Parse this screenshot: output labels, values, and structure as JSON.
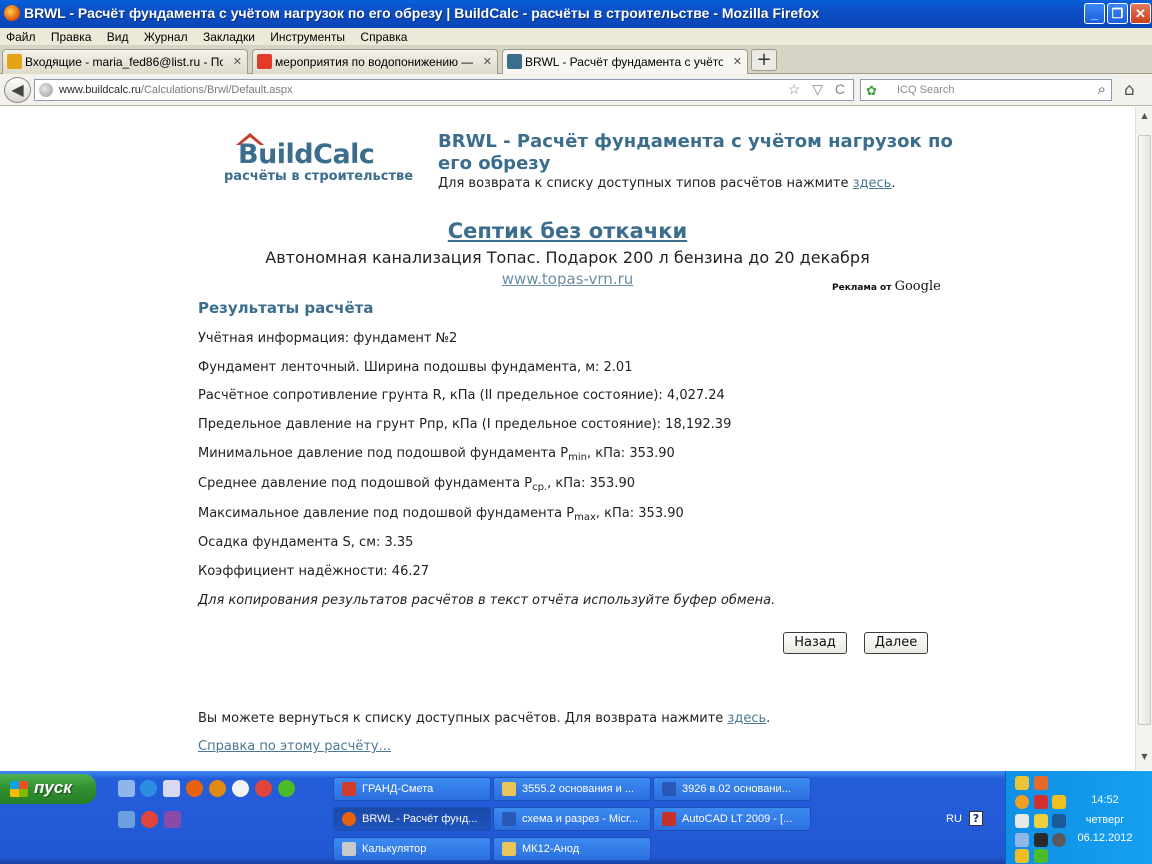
{
  "window": {
    "title": "BRWL - Расчёт фундамента с учётом нагрузок по его обрезу | BuildCalc - расчёты в строительстве - Mozilla Firefox",
    "minimize": "_",
    "maximize": "❐",
    "close": "✕"
  },
  "menu": [
    "Файл",
    "Правка",
    "Вид",
    "Журнал",
    "Закладки",
    "Инструменты",
    "Справка"
  ],
  "tabs": [
    {
      "label": "Входящие - maria_fed86@list.ru - Почт...",
      "icon_color": "#e5a415"
    },
    {
      "label": "мероприятия по водопонижению — Ян...",
      "icon_color": "#e23b2a"
    },
    {
      "label": "BRWL - Расчёт фундамента с учётом н...",
      "icon_color": "#3b6d8d"
    }
  ],
  "new_tab_label": "+",
  "nav": {
    "back": "◀",
    "url_host": "www.buildcalc.ru",
    "url_path": "/Calculations/Brwl/Default.aspx",
    "url_tools": "☆ ▽ C",
    "search_engine_icon": "✿",
    "search_placeholder": "ICQ Search",
    "search_icon": "⌕",
    "home_icon": "⌂"
  },
  "page": {
    "logo_name": "BuildCalc",
    "logo_tagline": "расчёты в строительстве",
    "title": "BRWL - Расчёт фундамента с учётом нагрузок по его обрезу",
    "return_text": "Для возврата к списку доступных типов расчётов нажмите ",
    "return_link": "здесь",
    "return_tail": ".",
    "ad": {
      "title": "Септик без откачки",
      "text": "Автономная канализация Топас. Подарок 200 л бензина до 20 декабря",
      "url": "www.topas-vrn.ru",
      "google_prefix": "Реклама от ",
      "google_brand": "Google"
    },
    "results_heading": "Результаты расчёта",
    "rows": [
      "Учётная информация: фундамент №2",
      "Фундамент ленточный. Ширина подошвы фундамента, м: 2.01",
      "Расчётное сопротивление грунта R, кПа (II предельное состояние): 4,027.24",
      "Предельное давление на грунт Pпр, кПа (I предельное состояние): 18,192.39"
    ],
    "pmin": {
      "pre": "Минимальное давление под подошвой фундамента P",
      "sub": "min",
      "post": ", кПа: 353.90"
    },
    "pcp": {
      "pre": "Среднее давление под подошвой фундамента P",
      "sub": "ср.",
      "post": ", кПа: 353.90"
    },
    "pmax": {
      "pre": "Максимальное давление под подошвой фундамента P",
      "sub": "max",
      "post": ", кПа: 353.90"
    },
    "rows2": [
      "Осадка фундамента S, см: 3.35",
      "Коэффициент надёжности: 46.27"
    ],
    "note": "Для копирования результатов расчётов в текст отчёта используйте буфер обмена.",
    "back_button": "Назад",
    "next_button": "Далее",
    "footer_text": "Вы можете вернуться к списку доступных расчётов. Для возврата нажмите ",
    "footer_link": "здесь",
    "footer_tail": ".",
    "help_link": "Справка по этому расчёту..."
  },
  "taskbar": {
    "start": "пуск",
    "buttons": [
      {
        "label": "ГРАНД-Смета",
        "icon_color": "#d23c2c"
      },
      {
        "label": "3555.2 основания и ...",
        "icon_color": "#e9c45a"
      },
      {
        "label": "3926 в.02 основани...",
        "icon_color": "#2b57b7"
      },
      {
        "label": "BRWL - Расчёт фунд...",
        "icon_color": "#e8610c"
      },
      {
        "label": "схема и разрез - Micr...",
        "icon_color": "#2b57b7"
      },
      {
        "label": "AutoCAD LT 2009 - [...",
        "icon_color": "#c8312a"
      },
      {
        "label": "Калькулятор",
        "icon_color": "#c9c9c9"
      },
      {
        "label": "МК12-Анод",
        "icon_color": "#e9c45a"
      }
    ],
    "language": "RU",
    "help_icon": "?",
    "time": "14:52",
    "day": "четверг",
    "date": "06.12.2012"
  }
}
